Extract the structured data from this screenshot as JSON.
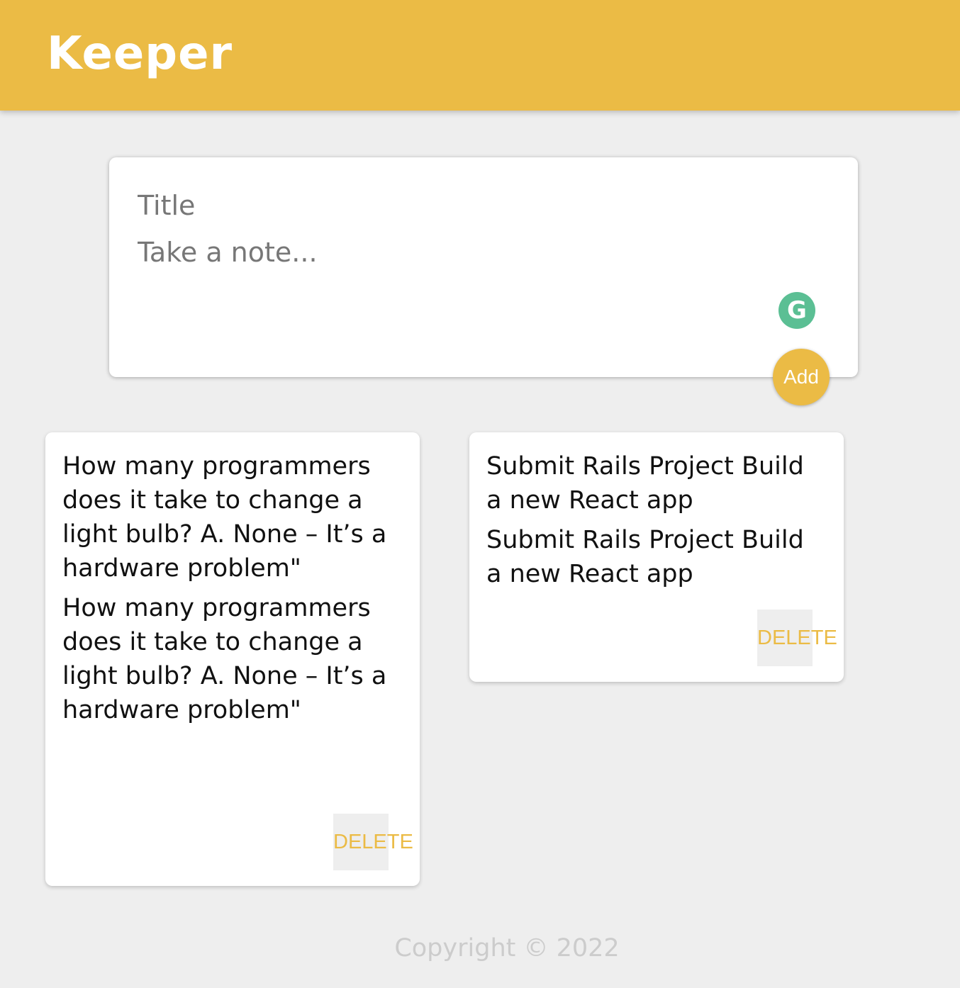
{
  "header": {
    "title": "Keeper"
  },
  "create_area": {
    "title_placeholder": "Title",
    "content_placeholder": "Take a note...",
    "grammarly_glyph": "G",
    "add_label": "Add"
  },
  "notes": [
    {
      "title": "How many programmers does it take to change a light bulb? A. None – It’s a hardware problem\"",
      "content": "How many programmers does it take to change a light bulb? A. None – It’s a hardware problem\"",
      "delete_label": "DELETE"
    },
    {
      "title": "Submit Rails Project Build a new React app",
      "content": "Submit Rails Project Build a new React app",
      "delete_label": "DELETE"
    }
  ],
  "footer": {
    "copyright": "Copyright © 2022"
  },
  "colors": {
    "accent": "#ebbb45",
    "background": "#eeeeee",
    "grammarly": "#5bbf94"
  }
}
